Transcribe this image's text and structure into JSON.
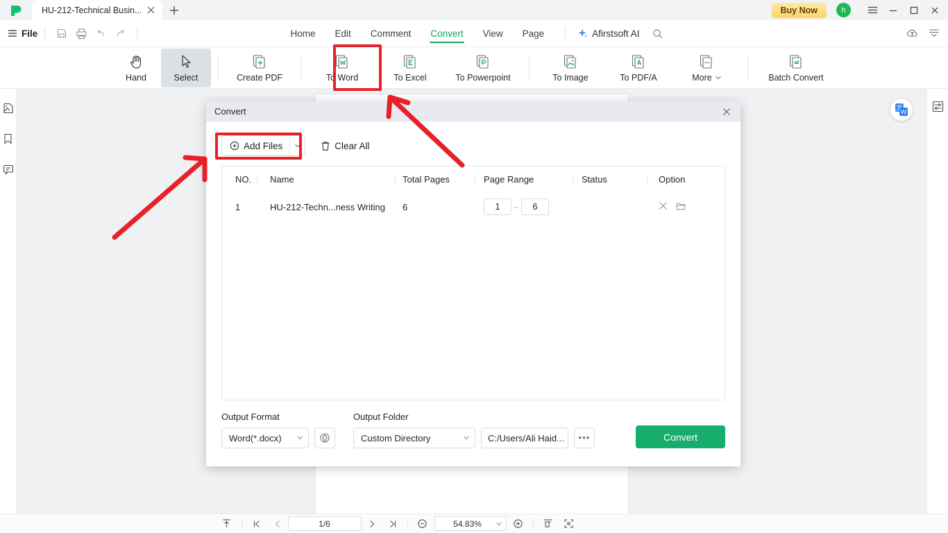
{
  "window": {
    "tab_title": "HU-212-Technical Busin...",
    "buy_now": "Buy Now",
    "avatar_initial": "h",
    "accent_green": "#10a35f",
    "convert_green": "#17ad6c",
    "annotation_red": "#e8202a"
  },
  "menubar": {
    "file_label": "File",
    "items": [
      {
        "label": "Home",
        "active": false
      },
      {
        "label": "Edit",
        "active": false
      },
      {
        "label": "Comment",
        "active": false
      },
      {
        "label": "Convert",
        "active": true
      },
      {
        "label": "View",
        "active": false
      },
      {
        "label": "Page",
        "active": false
      }
    ],
    "ai_label": "Afirstsoft AI"
  },
  "ribbon": {
    "items": [
      {
        "label": "Hand",
        "icon": "hand-icon",
        "selected": false
      },
      {
        "label": "Select",
        "icon": "cursor-icon",
        "selected": true
      },
      {
        "label": "Create PDF",
        "icon": "create-pdf-icon",
        "selected": false
      },
      {
        "label": "To Word",
        "icon": "to-word-icon",
        "selected": false,
        "highlighted": true
      },
      {
        "label": "To Excel",
        "icon": "to-excel-icon",
        "selected": false
      },
      {
        "label": "To Powerpoint",
        "icon": "to-powerpoint-icon",
        "selected": false
      },
      {
        "label": "To Image",
        "icon": "to-image-icon",
        "selected": false
      },
      {
        "label": "To PDF/A",
        "icon": "to-pdfa-icon",
        "selected": false
      },
      {
        "label": "More",
        "icon": "more-icon",
        "selected": false
      },
      {
        "label": "Batch Convert",
        "icon": "batch-convert-icon",
        "selected": false
      }
    ]
  },
  "dialog": {
    "title": "Convert",
    "add_files_label": "Add Files",
    "clear_all_label": "Clear All",
    "columns": [
      "NO.",
      "Name",
      "Total Pages",
      "Page Range",
      "Status",
      "Option"
    ],
    "rows": [
      {
        "no": "1",
        "name": "HU-212-Techn...ness Writing",
        "total_pages": "6",
        "range_from": "1",
        "range_to": "6",
        "range_dash": "–",
        "status": ""
      }
    ],
    "output_format_label": "Output Format",
    "output_format_value": "Word(*.docx)",
    "output_folder_label": "Output Folder",
    "output_folder_value": "Custom Directory",
    "output_path_value": "C:/Users/Ali Haid...",
    "more_path_label": "•••",
    "convert_label": "Convert"
  },
  "statusbar": {
    "page_indicator": "1/6",
    "zoom_level": "54.83%"
  },
  "icons": {
    "app_logo": "afirstsoft-logo-icon",
    "tab_close": "close-icon",
    "new_tab": "new-tab-icon",
    "hamburger": "hamburger-menu-icon",
    "minimize": "minimize-icon",
    "maximize": "maximize-icon",
    "window_close": "window-close-icon",
    "save": "save-icon",
    "print": "print-icon",
    "undo": "undo-icon",
    "redo": "redo-icon",
    "search": "search-icon",
    "cloud_upload": "cloud-upload-icon",
    "collapse_panel": "collapse-panel-icon",
    "thumbnails": "thumbnails-icon",
    "bookmark": "bookmark-icon",
    "comments": "comments-icon",
    "properties": "properties-icon",
    "translate": "translate-icon",
    "scroll_top": "scroll-to-top-icon",
    "first_page": "first-page-icon",
    "prev_page": "prev-page-icon",
    "next_page": "next-page-icon",
    "last_page": "last-page-icon",
    "zoom_out": "zoom-out-icon",
    "zoom_in": "zoom-in-icon",
    "fit_page": "fit-page-icon",
    "fit_width": "fit-width-icon",
    "row_remove": "remove-file-icon",
    "row_folder": "open-folder-icon",
    "settings_gear": "format-settings-icon",
    "add_circle": "add-circle-icon",
    "trash": "trash-icon"
  }
}
